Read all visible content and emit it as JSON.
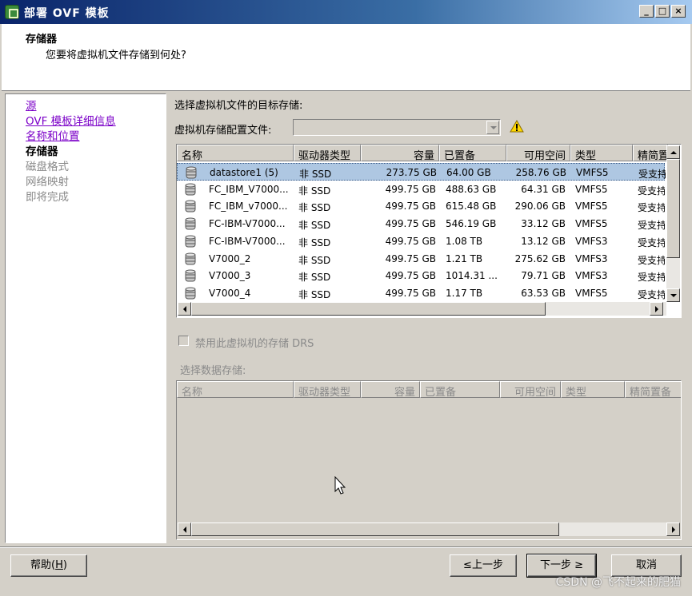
{
  "window": {
    "title": "部署 OVF 模板",
    "controls": [
      "_",
      "□",
      "×"
    ]
  },
  "header": {
    "title": "存储器",
    "subtitle": "您要将虚拟机文件存储到何处?"
  },
  "nav": {
    "items": [
      {
        "label": "源",
        "state": "link"
      },
      {
        "label": "OVF 模板详细信息",
        "state": "link"
      },
      {
        "label": "名称和位置",
        "state": "link"
      },
      {
        "label": "存储器",
        "state": "current"
      },
      {
        "label": "磁盘格式",
        "state": "disabled"
      },
      {
        "label": "网络映射",
        "state": "disabled"
      },
      {
        "label": "即将完成",
        "state": "disabled"
      }
    ]
  },
  "main": {
    "select_target_label": "选择虚拟机文件的目标存储:",
    "profile_label": "虚拟机存储配置文件:",
    "profile_value": "",
    "table": {
      "columns": [
        "名称",
        "驱动器类型",
        "容量",
        "已置备",
        "可用空间",
        "类型",
        "精简置"
      ],
      "rows": [
        {
          "name": "datastore1 (5)",
          "drive": "非 SSD",
          "capacity": "273.75 GB",
          "provisioned": "64.00 GB",
          "free": "258.76 GB",
          "type": "VMFS5",
          "thin": "受支持"
        },
        {
          "name": "FC_IBM_V7000...",
          "drive": "非 SSD",
          "capacity": "499.75 GB",
          "provisioned": "488.63 GB",
          "free": "64.31 GB",
          "type": "VMFS5",
          "thin": "受支持"
        },
        {
          "name": "FC_IBM_v7000...",
          "drive": "非 SSD",
          "capacity": "499.75 GB",
          "provisioned": "615.48 GB",
          "free": "290.06 GB",
          "type": "VMFS5",
          "thin": "受支持"
        },
        {
          "name": "FC-IBM-V7000...",
          "drive": "非 SSD",
          "capacity": "499.75 GB",
          "provisioned": "546.19 GB",
          "free": "33.12 GB",
          "type": "VMFS5",
          "thin": "受支持"
        },
        {
          "name": "FC-IBM-V7000...",
          "drive": "非 SSD",
          "capacity": "499.75 GB",
          "provisioned": "1.08 TB",
          "free": "13.12 GB",
          "type": "VMFS3",
          "thin": "受支持"
        },
        {
          "name": "V7000_2",
          "drive": "非 SSD",
          "capacity": "499.75 GB",
          "provisioned": "1.21 TB",
          "free": "275.62 GB",
          "type": "VMFS3",
          "thin": "受支持"
        },
        {
          "name": "V7000_3",
          "drive": "非 SSD",
          "capacity": "499.75 GB",
          "provisioned": "1014.31 ...",
          "free": "79.71 GB",
          "type": "VMFS3",
          "thin": "受支持"
        },
        {
          "name": "V7000_4",
          "drive": "非 SSD",
          "capacity": "499.75 GB",
          "provisioned": "1.17 TB",
          "free": "63.53 GB",
          "type": "VMFS5",
          "thin": "受支持"
        }
      ]
    },
    "disable_drs_label": "禁用此虚拟机的存储 DRS",
    "select_datastore_label": "选择数据存储:",
    "table2": {
      "columns": [
        "名称",
        "驱动器类型",
        "容量",
        "已置备",
        "可用空间",
        "类型",
        "精简置备"
      ]
    }
  },
  "buttons": {
    "help": "帮助(",
    "help_key": "H",
    "back_prefix": "≤",
    "back": "上一步",
    "next": "下一步",
    "next_suffix": "≥",
    "cancel": "取消"
  },
  "watermark": "CSDN @飞不起来的肥猫",
  "colors": {
    "selected_row": "#aec7e2",
    "link": "#7b00c8",
    "chrome": "#d4d0c8"
  }
}
